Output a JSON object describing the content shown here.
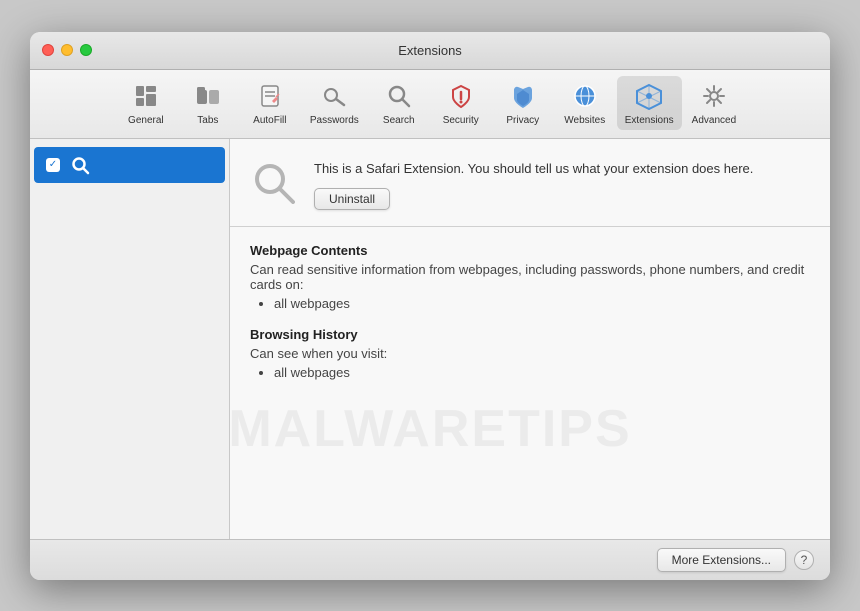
{
  "window": {
    "title": "Extensions"
  },
  "toolbar": {
    "items": [
      {
        "id": "general",
        "label": "General",
        "icon": "🗂"
      },
      {
        "id": "tabs",
        "label": "Tabs",
        "icon": "🃏"
      },
      {
        "id": "autofill",
        "label": "AutoFill",
        "icon": "✏️"
      },
      {
        "id": "passwords",
        "label": "Passwords",
        "icon": "🔑"
      },
      {
        "id": "search",
        "label": "Search",
        "icon": "🔍"
      },
      {
        "id": "security",
        "label": "Security",
        "icon": "🔒"
      },
      {
        "id": "privacy",
        "label": "Privacy",
        "icon": "✋"
      },
      {
        "id": "websites",
        "label": "Websites",
        "icon": "🌐"
      },
      {
        "id": "extensions",
        "label": "Extensions",
        "icon": "⚡"
      },
      {
        "id": "advanced",
        "label": "Advanced",
        "icon": "⚙️"
      }
    ]
  },
  "sidebar": {
    "extension_name": ""
  },
  "detail": {
    "description": "This is a Safari Extension. You should tell us what your extension does here.",
    "uninstall_label": "Uninstall",
    "permissions": [
      {
        "title": "Webpage Contents",
        "desc": "Can read sensitive information from webpages, including passwords, phone numbers, and credit cards on:",
        "items": [
          "all webpages"
        ]
      },
      {
        "title": "Browsing History",
        "desc": "Can see when you visit:",
        "items": [
          "all webpages"
        ]
      }
    ]
  },
  "footer": {
    "more_extensions_label": "More Extensions...",
    "help_label": "?"
  },
  "watermark": {
    "text": "MALWARETIPS"
  }
}
